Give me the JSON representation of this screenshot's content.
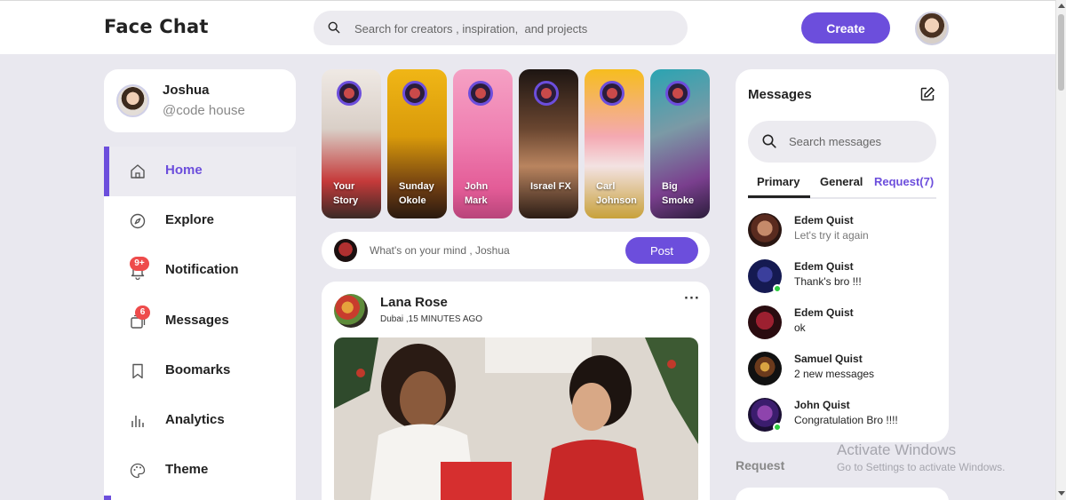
{
  "app": {
    "logo": "Face Chat"
  },
  "search": {
    "placeholder": "Search for creators , inspiration,  and projects"
  },
  "header": {
    "create_label": "Create"
  },
  "profile": {
    "name": "Joshua",
    "handle": "@code house"
  },
  "sidebar": {
    "items": [
      {
        "label": "Home",
        "icon": "home-icon",
        "active": true
      },
      {
        "label": "Explore",
        "icon": "compass-icon"
      },
      {
        "label": "Notification",
        "icon": "bell-icon",
        "badge": "9+"
      },
      {
        "label": "Messages",
        "icon": "messages-icon",
        "badge": "6"
      },
      {
        "label": "Boomarks",
        "icon": "bookmark-icon"
      },
      {
        "label": "Analytics",
        "icon": "analytics-icon"
      },
      {
        "label": "Theme",
        "icon": "palette-icon"
      }
    ]
  },
  "stories": [
    {
      "name": "Your Story"
    },
    {
      "name": "Sunday Okole"
    },
    {
      "name": "John Mark"
    },
    {
      "name": "Israel FX"
    },
    {
      "name": "Carl Johnson"
    },
    {
      "name": "Big Smoke"
    }
  ],
  "composer": {
    "placeholder": "What's on your mind , Joshua",
    "post_label": "Post"
  },
  "feed": {
    "post": {
      "author": "Lana Rose",
      "meta": "Dubai ,15 MINUTES AGO",
      "menu": "···"
    }
  },
  "messages": {
    "title": "Messages",
    "search_placeholder": "Search messages",
    "tabs": {
      "primary": "Primary",
      "general": "General",
      "request": "Request(7)"
    },
    "chats": [
      {
        "name": "Edem Quist",
        "text": "Let's try it again",
        "online": false,
        "muted": true
      },
      {
        "name": "Edem Quist",
        "text": "Thank's bro !!!",
        "online": true,
        "muted": false
      },
      {
        "name": "Edem Quist",
        "text": "ok",
        "online": false,
        "muted": false
      },
      {
        "name": "Samuel Quist",
        "text": "2 new messages",
        "online": false,
        "muted": false
      },
      {
        "name": "John Quist",
        "text": "Congratulation Bro !!!!",
        "online": true,
        "muted": false
      }
    ]
  },
  "requests": {
    "title": "Request"
  },
  "watermark": {
    "line1": "Activate Windows",
    "line2": "Go to Settings to activate Windows."
  },
  "colors": {
    "accent": "#6c4edc",
    "badge": "#ee4b4b",
    "online": "#2ecc40",
    "background": "#e9e8ef"
  }
}
